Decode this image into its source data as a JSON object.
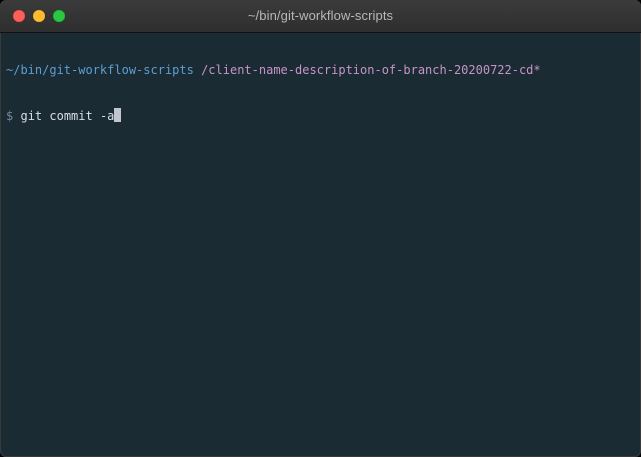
{
  "window": {
    "title": "~/bin/git-workflow-scripts"
  },
  "terminal": {
    "prompt_path": "~/bin/git-workflow-scripts",
    "prompt_branch": "/client-name-description-of-branch-20200722-cd*",
    "prompt_symbol": "$",
    "command": "git commit -a"
  },
  "colors": {
    "background": "#1b2b34",
    "path": "#5b9fd4",
    "branch": "#c594c5",
    "text": "#d8dee9"
  },
  "icons": [
    "close-button",
    "minimize-button",
    "zoom-button"
  ]
}
